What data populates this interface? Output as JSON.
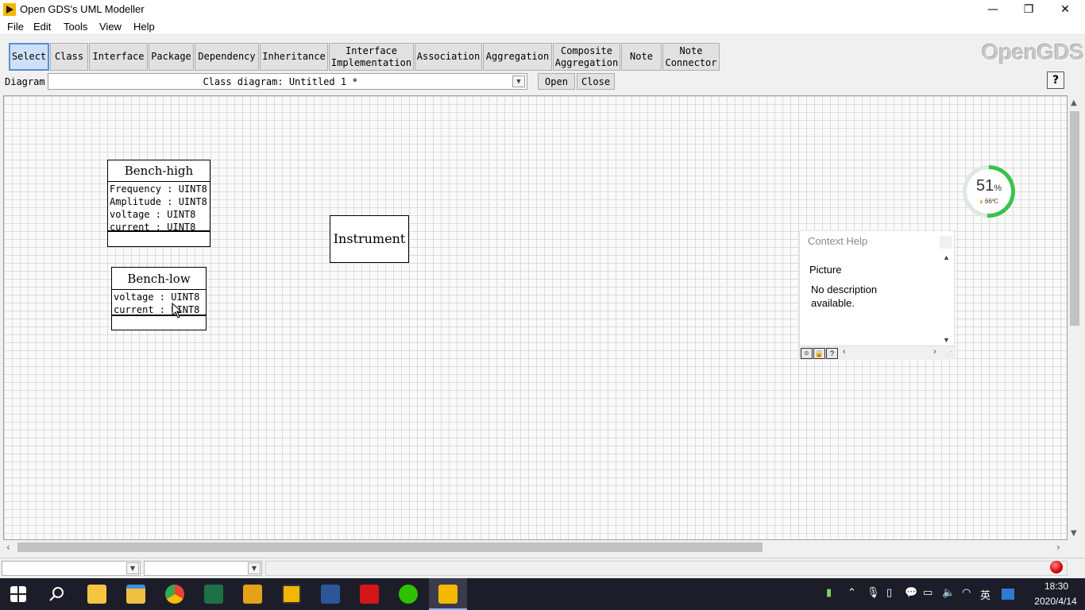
{
  "window": {
    "title": "Open GDS's UML Modeller",
    "minimize_glyph": "—",
    "restore_glyph": "❐",
    "close_glyph": "✕"
  },
  "menu": [
    "File",
    "Edit",
    "Tools",
    "View",
    "Help"
  ],
  "toolbar": {
    "buttons": [
      "Select",
      "Class",
      "Interface",
      "Package",
      "Dependency",
      "Inheritance",
      "Interface\nImplementation",
      "Association",
      "Aggregation",
      "Composite\nAggregation",
      "Note",
      "Note\nConnector"
    ],
    "active": "Select",
    "logo": "OpenGDS",
    "help_glyph": "?"
  },
  "diagram_bar": {
    "label": "Diagram",
    "selected": "Class diagram: Untitled 1 *",
    "open_label": "Open",
    "close_label": "Close"
  },
  "classes": [
    {
      "name": "Bench-high",
      "attributes": [
        "Frequency : UINT8",
        "Amplitude : UINT8",
        "voltage : UINT8",
        "current : UINT8"
      ]
    },
    {
      "name": "Bench-low",
      "attributes": [
        "voltage : UINT8",
        "current : UINT8"
      ]
    },
    {
      "name": "Instrument",
      "attributes": []
    }
  ],
  "context_help": {
    "title": "Context Help",
    "heading": "Picture",
    "body": "No description available."
  },
  "cpu_widget": {
    "percent": 51,
    "unit": "%",
    "temperature": "66℃",
    "ring_color": "#3ac24a"
  },
  "taskbar": {
    "time": "18:30",
    "date": "2020/4/14",
    "ime": "英",
    "apps": [
      "windows-start",
      "search",
      "explorer-folder",
      "file-explorer",
      "chrome",
      "excel",
      "vi-app",
      "ebook-app",
      "word",
      "acrobat",
      "wechat",
      "labview"
    ]
  }
}
